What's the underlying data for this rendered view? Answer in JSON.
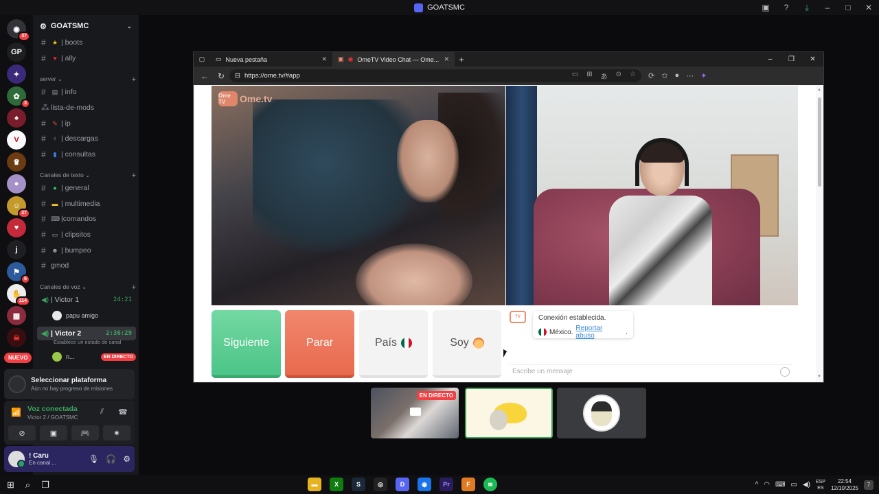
{
  "window": {
    "title": "GOATSMC"
  },
  "rail": {
    "servers": [
      {
        "label": "",
        "badge": "37"
      },
      {
        "label": "GP",
        "badge": ""
      },
      {
        "label": "",
        "badge": ""
      },
      {
        "label": "",
        "badge": "3"
      },
      {
        "label": "",
        "badge": ""
      },
      {
        "label": "",
        "badge": ""
      },
      {
        "label": "",
        "badge": ""
      },
      {
        "label": "",
        "badge": ""
      },
      {
        "label": "",
        "badge": "27"
      },
      {
        "label": "",
        "badge": ""
      },
      {
        "label": "j",
        "badge": ""
      },
      {
        "label": "",
        "badge": "6"
      },
      {
        "label": "",
        "badge": "114"
      },
      {
        "label": "",
        "badge": ""
      },
      {
        "label": "",
        "badge": ""
      }
    ],
    "new_label": "NUEVO"
  },
  "sidebar": {
    "guild_name": "GOATSMC",
    "top_channels": [
      {
        "name": "| boots",
        "emoji": "★"
      },
      {
        "name": "| ally",
        "emoji": "♥"
      }
    ],
    "category_server": "server",
    "server_channels": [
      {
        "name": "| info",
        "emoji": "▤"
      },
      {
        "name": "lista-de-mods",
        "emoji": ""
      },
      {
        "name": "| ip",
        "emoji": "✎"
      },
      {
        "name": "| descargas",
        "emoji": "♀"
      },
      {
        "name": "| consultas",
        "emoji": "▮"
      }
    ],
    "category_text": "Canales de texto",
    "text_channels": [
      {
        "name": "| general",
        "emoji": "●"
      },
      {
        "name": "| multimedia",
        "emoji": "▬"
      },
      {
        "name": "|comandos",
        "emoji": "⌨"
      },
      {
        "name": "| clipsitos",
        "emoji": "▭"
      },
      {
        "name": "| bumpeo",
        "emoji": "☻"
      },
      {
        "name": "gmod",
        "emoji": ""
      }
    ],
    "category_voice": "Canales de voz",
    "voice_channels": [
      {
        "name": "| Victor 1",
        "time": "24:21",
        "user": "papu amigo"
      },
      {
        "name": "| Victor 2",
        "time": "2:36:29",
        "status": "Establece un estado de canal",
        "user": "n...",
        "live": "EN DIRECTO"
      }
    ]
  },
  "panel": {
    "platform_title": "Seleccionar plataforma",
    "platform_sub": "Aún no hay progreso de misiones",
    "voice_status": "Voz conectada",
    "voice_location": "Victor 2 / GOATSMC",
    "user_name": "! Caru",
    "user_status": "En canal ..."
  },
  "browser": {
    "tabs": [
      {
        "label": "Nueva pestaña"
      },
      {
        "label": "OmeTV Video Chat — Ome..."
      }
    ],
    "url": "https://ome.tv/#app"
  },
  "ometv": {
    "logo_text": "Ome.tv",
    "logo_badge": "Ome TV",
    "buttons": {
      "next": "Siguiente",
      "stop": "Parar",
      "country": "País",
      "soy": "Soy"
    },
    "chat": {
      "status": "Conexión establecida.",
      "country": "México.",
      "report": "Reportar abuso",
      "placeholder": "Escribe un mensaje"
    },
    "colors": {
      "next": "#4cc487",
      "stop": "#e86a4e",
      "flag_green": "#006847",
      "flag_white": "#ffffff",
      "flag_red": "#ce1126"
    }
  },
  "streams": {
    "live_label": "EN DIRECTO"
  },
  "taskbar": {
    "lang_top": "ESP",
    "lang_bottom": "ES",
    "time": "22:54",
    "date": "12/10/2025",
    "notifications": "7"
  }
}
